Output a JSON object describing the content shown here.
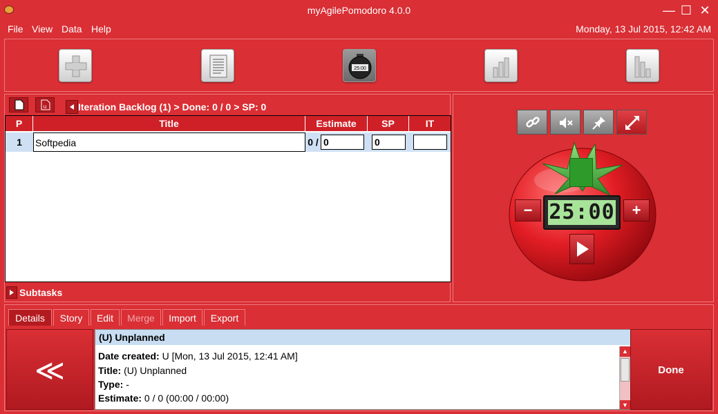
{
  "window": {
    "title": "myAgilePomodoro 4.0.0",
    "minimize": "—",
    "maximize": "☐",
    "close": "✕"
  },
  "menu": {
    "items": [
      "File",
      "View",
      "Data",
      "Help"
    ],
    "datetime": "Monday, 13 Jul 2015, 12:42 AM"
  },
  "toolbar": {
    "buttons": [
      {
        "name": "add",
        "icon": "plus-icon"
      },
      {
        "name": "list",
        "icon": "document-list-icon"
      },
      {
        "name": "timer",
        "icon": "stopwatch-icon",
        "label": "25:00"
      },
      {
        "name": "chart",
        "icon": "bar-chart-icon"
      },
      {
        "name": "burndown",
        "icon": "burndown-chart-icon"
      }
    ]
  },
  "backlog": {
    "breadcrumb": "Iteration Backlog (1) > Done: 0 / 0 > SP: 0",
    "columns": [
      "P",
      "Title",
      "Estimate",
      "SP",
      "IT"
    ],
    "rows": [
      {
        "p": "1",
        "title": "Softpedia",
        "estimate_prefix": "0 /",
        "estimate": "0",
        "sp": "0",
        "it": ""
      }
    ],
    "subtasks_label": "Subtasks"
  },
  "timer": {
    "display": "25:00",
    "minus": "−",
    "plus": "+",
    "controls": [
      {
        "name": "link",
        "icon": "link-icon"
      },
      {
        "name": "mute",
        "icon": "mute-icon"
      },
      {
        "name": "pin",
        "icon": "pin-icon"
      },
      {
        "name": "resize",
        "icon": "expand-icon"
      }
    ]
  },
  "tabs": {
    "items": [
      {
        "label": "Details",
        "active": true
      },
      {
        "label": "Story"
      },
      {
        "label": "Edit"
      },
      {
        "label": "Merge",
        "disabled": true
      },
      {
        "label": "Import"
      },
      {
        "label": "Export"
      }
    ]
  },
  "details": {
    "header": "(U) Unplanned",
    "lines": [
      {
        "key": "Date created:",
        "value": "U [Mon, 13 Jul 2015, 12:41 AM]"
      },
      {
        "key": "Title:",
        "value": "(U) Unplanned"
      },
      {
        "key": "Type:",
        "value": "-"
      },
      {
        "key": "Estimate:",
        "value": "0 / 0 (00:00 / 00:00)"
      }
    ]
  },
  "nav": {
    "back": "≪",
    "done": "Done"
  },
  "colors": {
    "background": "#d92f35",
    "header_red": "#cf2027",
    "row_highlight": "#cfe0f4",
    "lcd_green": "#a8e39a"
  }
}
